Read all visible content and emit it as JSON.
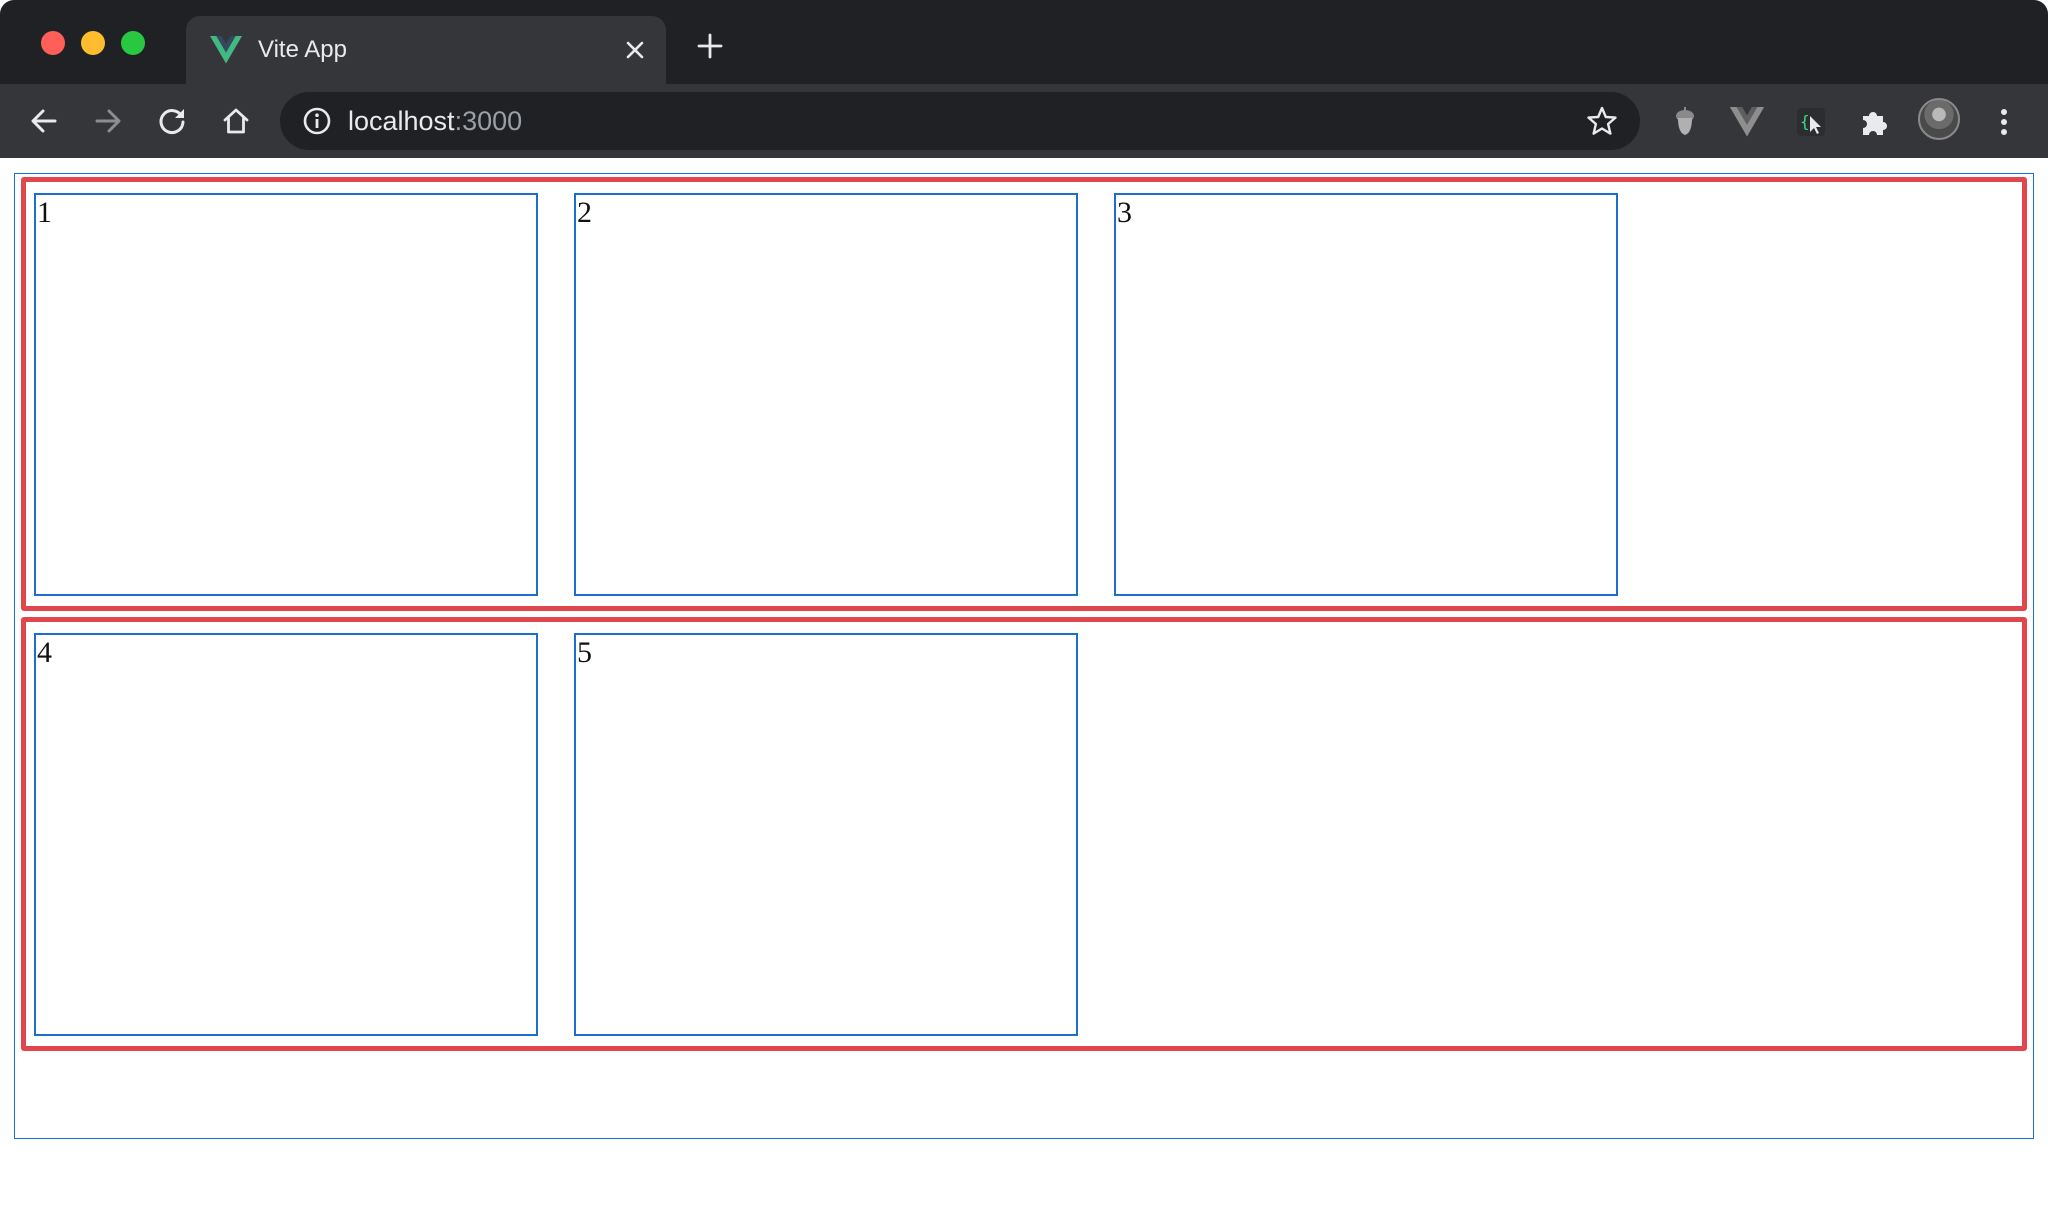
{
  "browser": {
    "tab_title": "Vite App",
    "url_host": "localhost",
    "url_port": ":3000",
    "icons": {
      "back": "arrow-left-icon",
      "forward": "arrow-right-icon",
      "reload": "reload-icon",
      "home": "home-icon",
      "info": "info-icon",
      "bookmark": "star-icon",
      "extensions": [
        "acorn-extension-icon",
        "vue-devtools-icon",
        "code-cursor-extension-icon",
        "puzzle-extensions-icon"
      ],
      "menu": "kebab-menu-icon"
    }
  },
  "page": {
    "rows": [
      {
        "cards": [
          "1",
          "2",
          "3"
        ]
      },
      {
        "cards": [
          "4",
          "5"
        ]
      }
    ]
  },
  "colors": {
    "row_border": "#e0464c",
    "card_border": "#1a6fd1",
    "vue_green": "#42b883",
    "vue_dark": "#35495e"
  }
}
